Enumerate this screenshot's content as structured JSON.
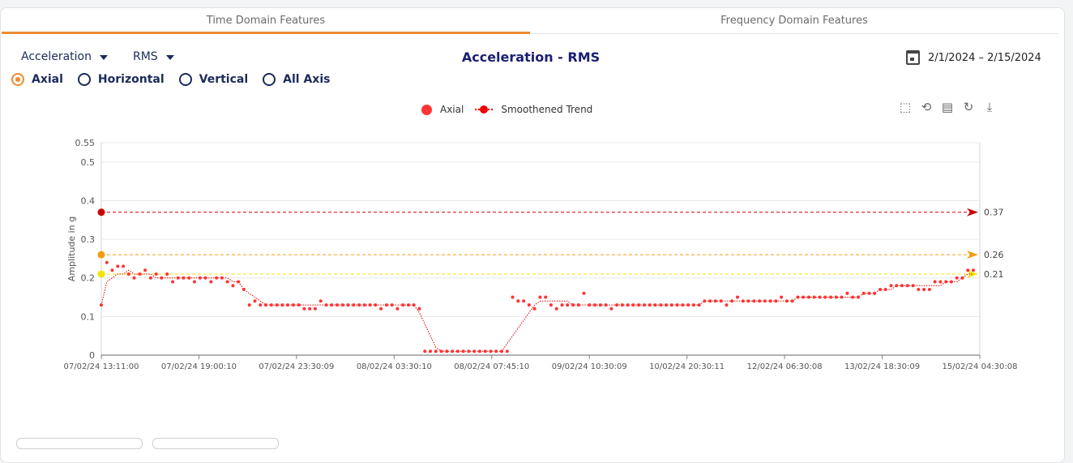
{
  "tabs": [
    {
      "label": "Time Domain Features",
      "active": true
    },
    {
      "label": "Frequency Domain Features",
      "active": false
    }
  ],
  "controls": {
    "measure_label": "Acceleration",
    "stat_label": "RMS",
    "date_range": "2/1/2024 – 2/15/2024"
  },
  "axis_options": [
    {
      "label": "Axial",
      "selected": true
    },
    {
      "label": "Horizontal",
      "selected": false
    },
    {
      "label": "Vertical",
      "selected": false
    },
    {
      "label": "All Axis",
      "selected": false
    }
  ],
  "toolbox_icons": [
    "zoom-icon",
    "zoom-reset-icon",
    "data-view-icon",
    "restore-icon",
    "download-icon"
  ],
  "colors": {
    "accent": "#ef8a33",
    "series": "#ff3333",
    "trend": "#e00000",
    "alarm": "#cc0000",
    "warning": "#f39c12",
    "alert": "#f4e300"
  },
  "chart_data": {
    "type": "scatter",
    "title": "Acceleration - RMS",
    "ylabel": "Amplitude in g",
    "ylim": [
      0,
      0.55
    ],
    "yticks": [
      "0",
      "0.1",
      "0.2",
      "0.3",
      "0.4",
      "0.5",
      "0.55"
    ],
    "xticks": [
      "07/02/24 13:11:00",
      "07/02/24 19:00:10",
      "07/02/24 23:30:09",
      "08/02/24 03:30:10",
      "08/02/24 07:45:10",
      "09/02/24 10:30:09",
      "10/02/24 20:30:11",
      "12/02/24 06:30:08",
      "13/02/24 18:30:09",
      "15/02/24 04:30:08"
    ],
    "legend": [
      "Axial",
      "Smoothened Trend"
    ],
    "thresholds": [
      {
        "value": 0.37,
        "label": "0.37",
        "color": "#cc0000"
      },
      {
        "value": 0.26,
        "label": "0.26",
        "color": "#f39c12"
      },
      {
        "value": 0.21,
        "label": "0.21",
        "color": "#f4e300"
      }
    ],
    "series": [
      {
        "name": "Axial",
        "values": [
          0.13,
          0.24,
          0.22,
          0.23,
          0.23,
          0.21,
          0.2,
          0.21,
          0.22,
          0.2,
          0.21,
          0.2,
          0.21,
          0.19,
          0.2,
          0.2,
          0.2,
          0.19,
          0.2,
          0.2,
          0.19,
          0.2,
          0.2,
          0.19,
          0.18,
          0.19,
          0.17,
          0.13,
          0.14,
          0.13,
          0.13,
          0.13,
          0.13,
          0.13,
          0.13,
          0.13,
          0.13,
          0.12,
          0.12,
          0.12,
          0.14,
          0.13,
          0.13,
          0.13,
          0.13,
          0.13,
          0.13,
          0.13,
          0.13,
          0.13,
          0.13,
          0.12,
          0.13,
          0.13,
          0.12,
          0.13,
          0.13,
          0.13,
          0.12,
          0.01,
          0.01,
          0.01,
          0.01,
          0.01,
          0.01,
          0.01,
          0.01,
          0.01,
          0.01,
          0.01,
          0.01,
          0.01,
          0.01,
          0.01,
          0.01,
          0.15,
          0.14,
          0.14,
          0.13,
          0.12,
          0.15,
          0.15,
          0.13,
          0.12,
          0.13,
          0.13,
          0.13,
          0.13,
          0.16,
          0.13,
          0.13,
          0.13,
          0.13,
          0.12,
          0.13,
          0.13,
          0.13,
          0.13,
          0.13,
          0.13,
          0.13,
          0.13,
          0.13,
          0.13,
          0.13,
          0.13,
          0.13,
          0.13,
          0.13,
          0.13,
          0.14,
          0.14,
          0.14,
          0.14,
          0.13,
          0.14,
          0.15,
          0.14,
          0.14,
          0.14,
          0.14,
          0.14,
          0.14,
          0.14,
          0.15,
          0.14,
          0.14,
          0.15,
          0.15,
          0.15,
          0.15,
          0.15,
          0.15,
          0.15,
          0.15,
          0.15,
          0.16,
          0.15,
          0.15,
          0.16,
          0.16,
          0.16,
          0.17,
          0.17,
          0.18,
          0.18,
          0.18,
          0.18,
          0.18,
          0.17,
          0.17,
          0.17,
          0.19,
          0.19,
          0.19,
          0.19,
          0.2,
          0.2,
          0.22,
          0.22
        ]
      },
      {
        "name": "Smoothened Trend",
        "values": [
          0.13,
          0.19,
          0.2,
          0.21,
          0.21,
          0.22,
          0.21,
          0.21,
          0.21,
          0.21,
          0.2,
          0.2,
          0.2,
          0.2,
          0.2,
          0.2,
          0.2,
          0.2,
          0.2,
          0.2,
          0.2,
          0.2,
          0.2,
          0.2,
          0.19,
          0.19,
          0.17,
          0.16,
          0.15,
          0.14,
          0.13,
          0.13,
          0.13,
          0.13,
          0.13,
          0.13,
          0.13,
          0.13,
          0.13,
          0.13,
          0.13,
          0.13,
          0.13,
          0.13,
          0.13,
          0.13,
          0.13,
          0.13,
          0.13,
          0.13,
          0.13,
          0.13,
          0.13,
          0.13,
          0.13,
          0.13,
          0.13,
          0.13,
          0.11,
          0.08,
          0.05,
          0.02,
          0.01,
          0.01,
          0.01,
          0.01,
          0.01,
          0.01,
          0.01,
          0.01,
          0.01,
          0.01,
          0.01,
          0.01,
          0.03,
          0.05,
          0.07,
          0.09,
          0.11,
          0.13,
          0.14,
          0.14,
          0.14,
          0.14,
          0.14,
          0.14,
          0.13,
          0.13,
          0.13,
          0.13,
          0.13,
          0.13,
          0.13,
          0.13,
          0.13,
          0.13,
          0.13,
          0.13,
          0.13,
          0.13,
          0.13,
          0.13,
          0.13,
          0.13,
          0.13,
          0.13,
          0.13,
          0.13,
          0.13,
          0.13,
          0.14,
          0.14,
          0.14,
          0.14,
          0.14,
          0.14,
          0.14,
          0.14,
          0.14,
          0.14,
          0.14,
          0.14,
          0.14,
          0.14,
          0.14,
          0.14,
          0.14,
          0.15,
          0.15,
          0.15,
          0.15,
          0.15,
          0.15,
          0.15,
          0.15,
          0.15,
          0.15,
          0.15,
          0.15,
          0.16,
          0.16,
          0.16,
          0.17,
          0.17,
          0.17,
          0.18,
          0.18,
          0.18,
          0.18,
          0.18,
          0.18,
          0.18,
          0.18,
          0.18,
          0.19,
          0.19,
          0.19,
          0.2,
          0.21,
          0.21
        ]
      }
    ]
  }
}
